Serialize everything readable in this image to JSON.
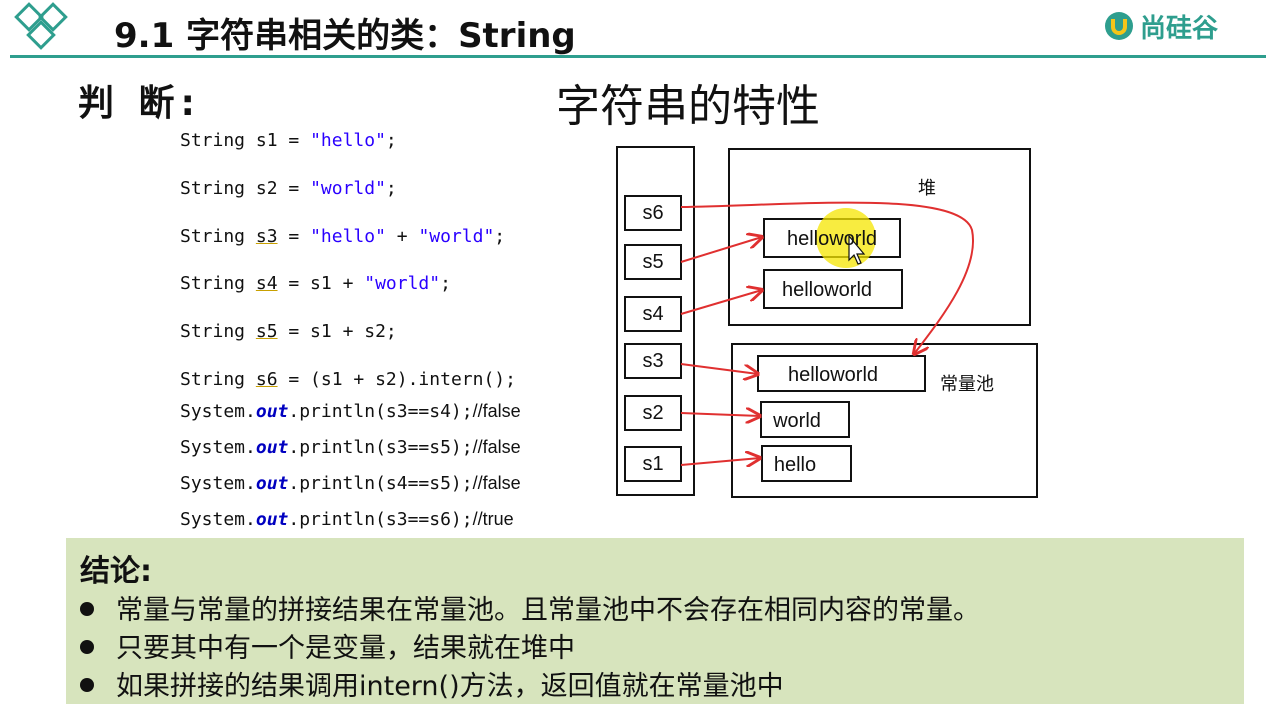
{
  "header": {
    "title": "9.1 字符串相关的类：String",
    "brand": "尚硅谷",
    "accent_color": "#2e9e8e"
  },
  "judge_label": "判 断:",
  "diagram_title": "字符串的特性",
  "code": {
    "l1": {
      "a": "String ",
      "v": "s1",
      "b": " = ",
      "s": "\"hello\"",
      "c": ";"
    },
    "l2": {
      "a": "String ",
      "v": "s2",
      "b": " = ",
      "s": "\"world\"",
      "c": ";"
    },
    "l3": {
      "a": "String ",
      "v": "s3",
      "b": " = ",
      "s1": "\"hello\"",
      "m": " + ",
      "s2": "\"world\"",
      "c": ";"
    },
    "l4": {
      "a": "String ",
      "v": "s4",
      "b": " = s1 + ",
      "s": "\"world\"",
      "c": ";"
    },
    "l5": {
      "a": "String ",
      "v": "s5",
      "b": " = s1 + s2;"
    },
    "l6": {
      "a": "String ",
      "v": "s6",
      "b": " = (s1 + s2).intern();"
    },
    "p1": {
      "a": "System.",
      "k": "out",
      "b": ".println(s3==s4);",
      "c": "//false"
    },
    "p2": {
      "a": "System.",
      "k": "out",
      "b": ".println(s3==s5);",
      "c": "//false"
    },
    "p3": {
      "a": "System.",
      "k": "out",
      "b": ".println(s4==s5);",
      "c": "//false"
    },
    "p4": {
      "a": "System.",
      "k": "out",
      "b": ".println(s3==s6);",
      "c": "//true"
    }
  },
  "diagram": {
    "stack_vars": [
      "s6",
      "s5",
      "s4",
      "s3",
      "s2",
      "s1"
    ],
    "heap_label": "堆",
    "pool_label": "常量池",
    "heap_items": [
      "helloworld",
      "helloworld"
    ],
    "pool_items": [
      "helloworld",
      "world",
      "hello"
    ],
    "arrow_color": "#e03030"
  },
  "conclusion": {
    "title": "结论:",
    "bullets": [
      "常量与常量的拼接结果在常量池。且常量池中不会存在相同内容的常量。",
      "只要其中有一个是变量，结果就在堆中",
      "如果拼接的结果调用intern()方法，返回值就在常量池中"
    ],
    "bg_color": "#d7e4bd"
  }
}
